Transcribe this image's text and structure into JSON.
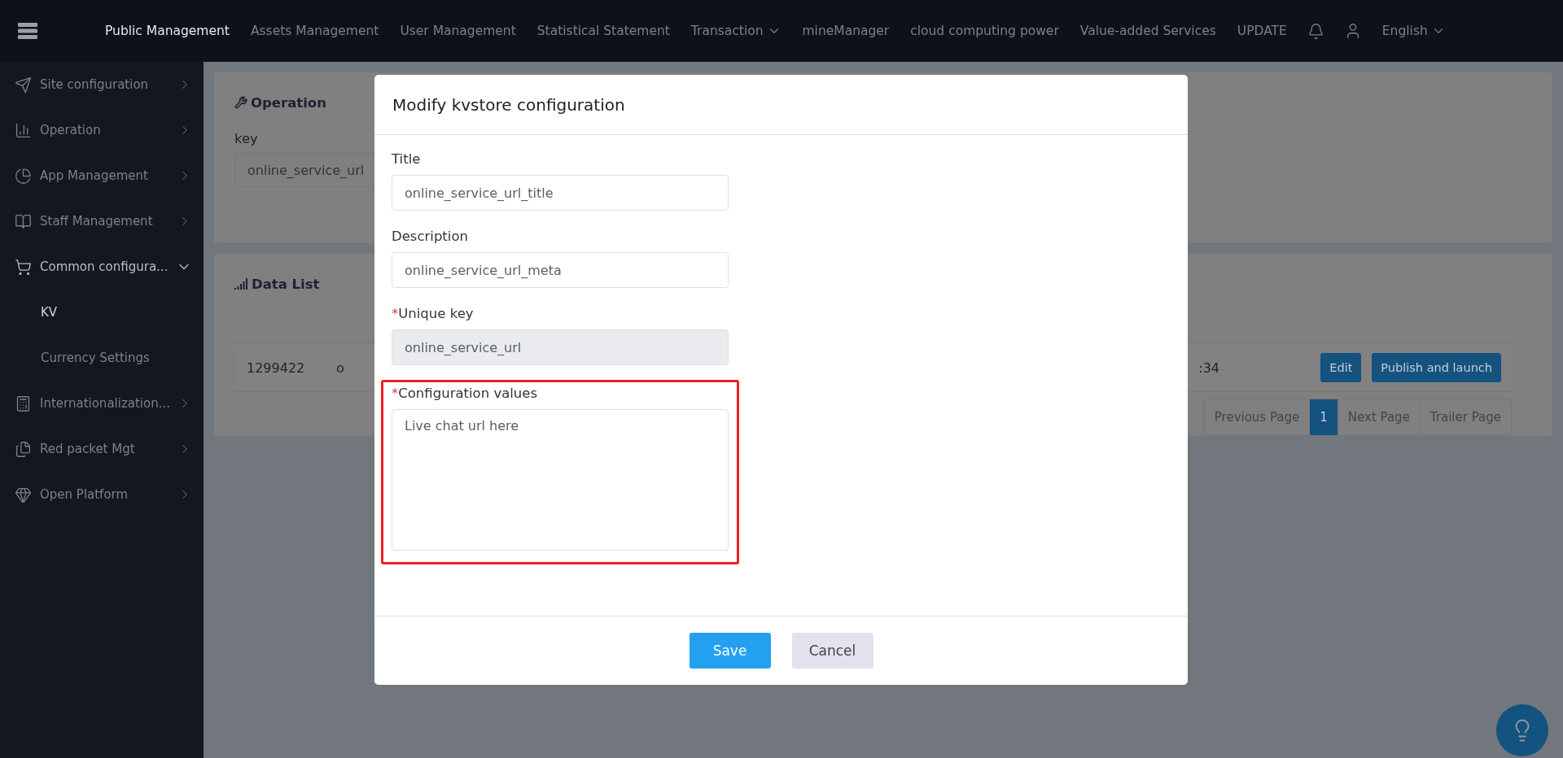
{
  "top_nav": {
    "items": [
      {
        "label": "Public Management",
        "selected": true,
        "dropdown": false
      },
      {
        "label": "Assets Management",
        "selected": false,
        "dropdown": false
      },
      {
        "label": "User Management",
        "selected": false,
        "dropdown": false
      },
      {
        "label": "Statistical Statement",
        "selected": false,
        "dropdown": false
      },
      {
        "label": "Transaction",
        "selected": false,
        "dropdown": true
      },
      {
        "label": "mineManager",
        "selected": false,
        "dropdown": false
      },
      {
        "label": "cloud computing power",
        "selected": false,
        "dropdown": false
      },
      {
        "label": "Value-added Services",
        "selected": false,
        "dropdown": false
      },
      {
        "label": "UPDATE",
        "selected": false,
        "dropdown": false
      }
    ],
    "language": "English"
  },
  "sidebar": {
    "items": [
      {
        "label": "Site configuration",
        "expanded": false
      },
      {
        "label": "Operation",
        "expanded": false
      },
      {
        "label": "App Management",
        "expanded": false
      },
      {
        "label": "Staff Management",
        "expanded": false
      },
      {
        "label": "Common configura...",
        "expanded": true,
        "children": [
          {
            "label": "KV",
            "selected": true
          },
          {
            "label": "Currency Settings",
            "selected": false
          }
        ]
      },
      {
        "label": "Internationalization...",
        "expanded": false
      },
      {
        "label": "Red packet Mgt",
        "expanded": false
      },
      {
        "label": "Open Platform",
        "expanded": false
      }
    ]
  },
  "operation_panel": {
    "title": "Operation",
    "key_label": "key",
    "key_value": "online_service_url"
  },
  "data_list": {
    "title": "Data List",
    "rows": [
      {
        "cells": [
          "1299422",
          "o",
          ":34"
        ],
        "actions": [
          "Edit",
          "Publish and launch"
        ]
      }
    ],
    "pagination": [
      {
        "label": "Previous Page",
        "selected": false
      },
      {
        "label": "1",
        "selected": true
      },
      {
        "label": "Next Page",
        "selected": false
      },
      {
        "label": "Trailer Page",
        "selected": false
      }
    ]
  },
  "modal": {
    "title": "Modify kvstore configuration",
    "fields": [
      {
        "label": "Title",
        "value": "online_service_url_title",
        "kind": "input",
        "disabled": false,
        "highlighted": false
      },
      {
        "label": "Description",
        "value": "online_service_url_meta",
        "kind": "input",
        "disabled": false,
        "highlighted": false
      },
      {
        "label": "Unique key",
        "required_mark": "*",
        "value": "online_service_url",
        "kind": "input",
        "disabled": true,
        "highlighted": false
      },
      {
        "label": "Configuration values",
        "required_mark": "*",
        "value": "Live chat url here",
        "kind": "textarea",
        "disabled": false,
        "highlighted": true
      }
    ],
    "buttons": [
      {
        "label": "Save",
        "kind": "primary"
      },
      {
        "label": "Cancel",
        "kind": "secondary"
      }
    ]
  }
}
